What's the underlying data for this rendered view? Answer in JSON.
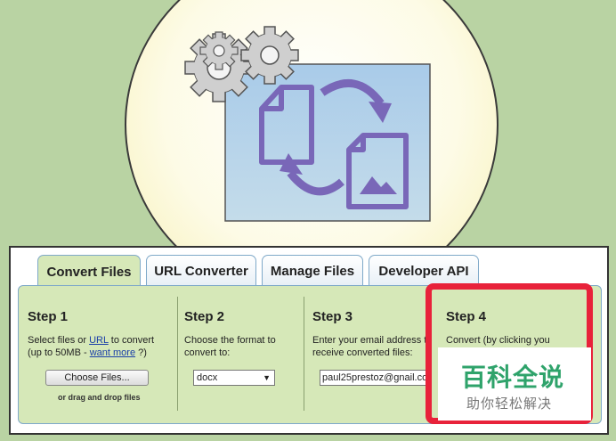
{
  "tabs": [
    {
      "label": "Convert Files",
      "active": true
    },
    {
      "label": "URL Converter",
      "active": false
    },
    {
      "label": "Manage Files",
      "active": false
    },
    {
      "label": "Developer API",
      "active": false
    }
  ],
  "step1": {
    "title": "Step 1",
    "line1_pre": "Select files or ",
    "line1_link": "URL",
    "line1_post": " to convert",
    "line2_pre": "(up to 50MB - ",
    "line2_link": "want more",
    "line2_post": " ?)",
    "button": "Choose Files...",
    "drop_text": "or drag and drop files"
  },
  "step2": {
    "title": "Step 2",
    "line1": "Choose the format to",
    "line2": "convert to:",
    "format_value": "docx"
  },
  "step3": {
    "title": "Step 3",
    "line1": "Enter your email address to",
    "line2": "receive converted files:",
    "email_value": "paul25prestoz@gnail.co"
  },
  "step4": {
    "title": "Step 4",
    "line1": "Convert (by clicking you"
  },
  "watermark": {
    "line1": "百科全说",
    "line2": "助你轻松解决"
  },
  "colors": {
    "background": "#b9d3a3",
    "panel_green": "#d6e8b8",
    "highlight_red": "#e8223a",
    "link_blue": "#1a3fa8",
    "watermark_green": "#2fa36b"
  },
  "icons": [
    "gear-icon",
    "document-icon",
    "image-file-icon",
    "convert-arrow-icon",
    "dropdown-arrow-icon"
  ]
}
